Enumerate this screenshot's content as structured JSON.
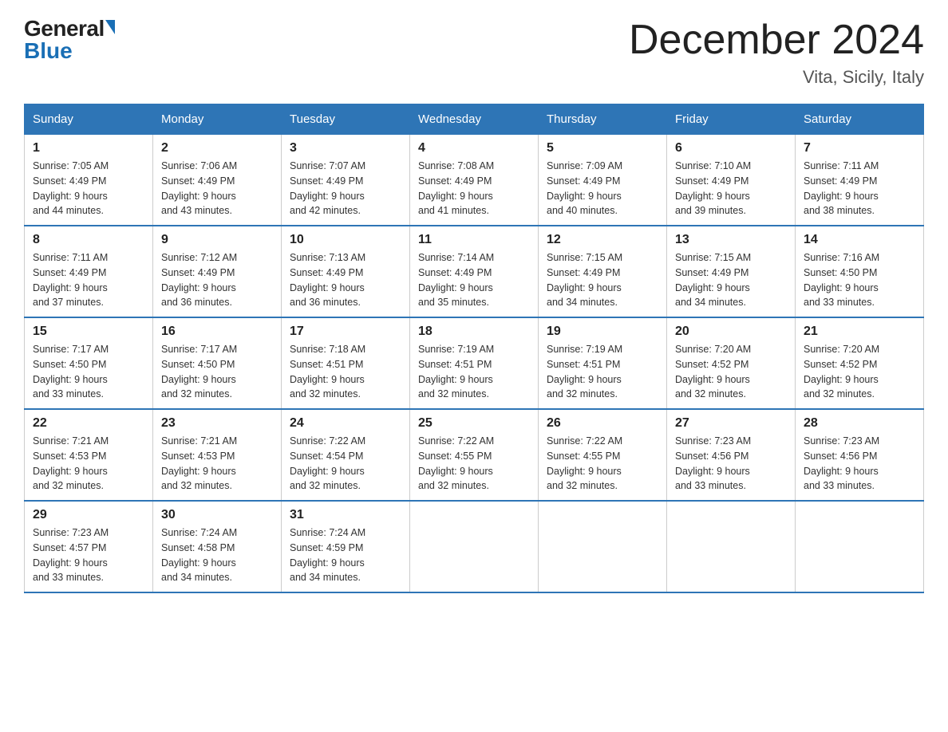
{
  "header": {
    "month_title": "December 2024",
    "location": "Vita, Sicily, Italy",
    "logo_top": "General",
    "logo_bottom": "Blue"
  },
  "days_of_week": [
    "Sunday",
    "Monday",
    "Tuesday",
    "Wednesday",
    "Thursday",
    "Friday",
    "Saturday"
  ],
  "weeks": [
    [
      {
        "day": "1",
        "sunrise": "7:05 AM",
        "sunset": "4:49 PM",
        "daylight": "9 hours and 44 minutes."
      },
      {
        "day": "2",
        "sunrise": "7:06 AM",
        "sunset": "4:49 PM",
        "daylight": "9 hours and 43 minutes."
      },
      {
        "day": "3",
        "sunrise": "7:07 AM",
        "sunset": "4:49 PM",
        "daylight": "9 hours and 42 minutes."
      },
      {
        "day": "4",
        "sunrise": "7:08 AM",
        "sunset": "4:49 PM",
        "daylight": "9 hours and 41 minutes."
      },
      {
        "day": "5",
        "sunrise": "7:09 AM",
        "sunset": "4:49 PM",
        "daylight": "9 hours and 40 minutes."
      },
      {
        "day": "6",
        "sunrise": "7:10 AM",
        "sunset": "4:49 PM",
        "daylight": "9 hours and 39 minutes."
      },
      {
        "day": "7",
        "sunrise": "7:11 AM",
        "sunset": "4:49 PM",
        "daylight": "9 hours and 38 minutes."
      }
    ],
    [
      {
        "day": "8",
        "sunrise": "7:11 AM",
        "sunset": "4:49 PM",
        "daylight": "9 hours and 37 minutes."
      },
      {
        "day": "9",
        "sunrise": "7:12 AM",
        "sunset": "4:49 PM",
        "daylight": "9 hours and 36 minutes."
      },
      {
        "day": "10",
        "sunrise": "7:13 AM",
        "sunset": "4:49 PM",
        "daylight": "9 hours and 36 minutes."
      },
      {
        "day": "11",
        "sunrise": "7:14 AM",
        "sunset": "4:49 PM",
        "daylight": "9 hours and 35 minutes."
      },
      {
        "day": "12",
        "sunrise": "7:15 AM",
        "sunset": "4:49 PM",
        "daylight": "9 hours and 34 minutes."
      },
      {
        "day": "13",
        "sunrise": "7:15 AM",
        "sunset": "4:49 PM",
        "daylight": "9 hours and 34 minutes."
      },
      {
        "day": "14",
        "sunrise": "7:16 AM",
        "sunset": "4:50 PM",
        "daylight": "9 hours and 33 minutes."
      }
    ],
    [
      {
        "day": "15",
        "sunrise": "7:17 AM",
        "sunset": "4:50 PM",
        "daylight": "9 hours and 33 minutes."
      },
      {
        "day": "16",
        "sunrise": "7:17 AM",
        "sunset": "4:50 PM",
        "daylight": "9 hours and 32 minutes."
      },
      {
        "day": "17",
        "sunrise": "7:18 AM",
        "sunset": "4:51 PM",
        "daylight": "9 hours and 32 minutes."
      },
      {
        "day": "18",
        "sunrise": "7:19 AM",
        "sunset": "4:51 PM",
        "daylight": "9 hours and 32 minutes."
      },
      {
        "day": "19",
        "sunrise": "7:19 AM",
        "sunset": "4:51 PM",
        "daylight": "9 hours and 32 minutes."
      },
      {
        "day": "20",
        "sunrise": "7:20 AM",
        "sunset": "4:52 PM",
        "daylight": "9 hours and 32 minutes."
      },
      {
        "day": "21",
        "sunrise": "7:20 AM",
        "sunset": "4:52 PM",
        "daylight": "9 hours and 32 minutes."
      }
    ],
    [
      {
        "day": "22",
        "sunrise": "7:21 AM",
        "sunset": "4:53 PM",
        "daylight": "9 hours and 32 minutes."
      },
      {
        "day": "23",
        "sunrise": "7:21 AM",
        "sunset": "4:53 PM",
        "daylight": "9 hours and 32 minutes."
      },
      {
        "day": "24",
        "sunrise": "7:22 AM",
        "sunset": "4:54 PM",
        "daylight": "9 hours and 32 minutes."
      },
      {
        "day": "25",
        "sunrise": "7:22 AM",
        "sunset": "4:55 PM",
        "daylight": "9 hours and 32 minutes."
      },
      {
        "day": "26",
        "sunrise": "7:22 AM",
        "sunset": "4:55 PM",
        "daylight": "9 hours and 32 minutes."
      },
      {
        "day": "27",
        "sunrise": "7:23 AM",
        "sunset": "4:56 PM",
        "daylight": "9 hours and 33 minutes."
      },
      {
        "day": "28",
        "sunrise": "7:23 AM",
        "sunset": "4:56 PM",
        "daylight": "9 hours and 33 minutes."
      }
    ],
    [
      {
        "day": "29",
        "sunrise": "7:23 AM",
        "sunset": "4:57 PM",
        "daylight": "9 hours and 33 minutes."
      },
      {
        "day": "30",
        "sunrise": "7:24 AM",
        "sunset": "4:58 PM",
        "daylight": "9 hours and 34 minutes."
      },
      {
        "day": "31",
        "sunrise": "7:24 AM",
        "sunset": "4:59 PM",
        "daylight": "9 hours and 34 minutes."
      },
      null,
      null,
      null,
      null
    ]
  ],
  "labels": {
    "sunrise": "Sunrise:",
    "sunset": "Sunset:",
    "daylight": "Daylight:"
  }
}
